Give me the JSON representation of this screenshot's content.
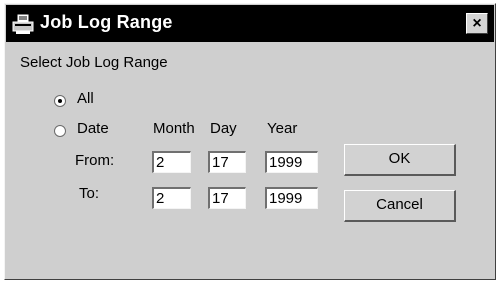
{
  "window": {
    "title": "Job Log Range",
    "close_glyph": "×",
    "icon": "printer-app-icon"
  },
  "dialog": {
    "heading": "Select Job Log Range",
    "options": {
      "all_label": "All",
      "date_label": "Date",
      "selected": "All"
    },
    "columns": {
      "month": "Month",
      "day": "Day",
      "year": "Year"
    },
    "from": {
      "label": "From:",
      "month": "2",
      "day": "17",
      "year": "1999"
    },
    "to": {
      "label": "To:",
      "month": "2",
      "day": "17",
      "year": "1999"
    },
    "buttons": {
      "ok": "OK",
      "cancel": "Cancel"
    }
  }
}
